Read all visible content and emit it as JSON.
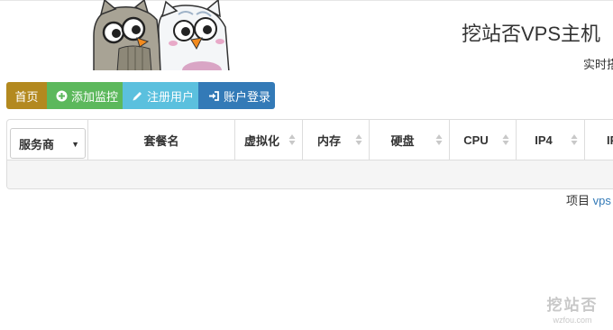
{
  "header": {
    "title": "挖站否VPS主机",
    "subtitle": "实时搭"
  },
  "nav": {
    "home": "首页",
    "add_monitor": "添加监控",
    "register": "注册用户",
    "login": "账户登录"
  },
  "table": {
    "provider_select": "服务商",
    "columns": [
      "套餐名",
      "虚拟化",
      "内存",
      "硬盘",
      "CPU",
      "IP4",
      "IP"
    ]
  },
  "footer": {
    "items_label": "项目",
    "link_text": "vps"
  },
  "watermark": {
    "big": "挖站否",
    "small": "wzfou.com"
  },
  "colors": {
    "home": "#b3891f",
    "add": "#5cb85c",
    "register": "#5bc0de",
    "login": "#337ab7"
  }
}
